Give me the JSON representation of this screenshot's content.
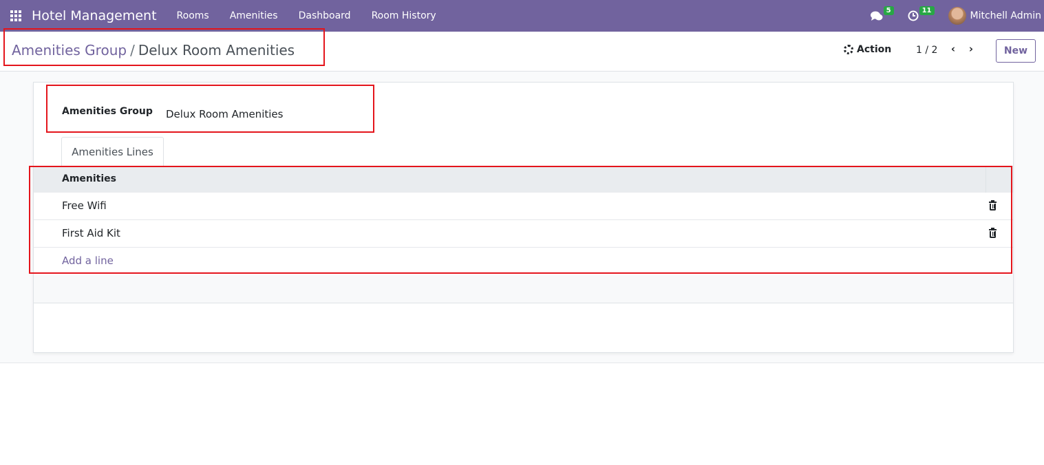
{
  "navbar": {
    "app_name": "Hotel Management",
    "menu": [
      "Rooms",
      "Amenities",
      "Dashboard",
      "Room History"
    ],
    "messages_count": "5",
    "activities_count": "11",
    "user_name": "Mitchell Admin",
    "bg_color": "#71639e"
  },
  "control_panel": {
    "breadcrumb_parent": "Amenities Group",
    "breadcrumb_separator": "/",
    "breadcrumb_current": "Delux Room Amenities",
    "action_label": "Action",
    "pager": "1 / 2",
    "new_label": "New"
  },
  "form": {
    "group_label": "Amenities Group",
    "group_value": "Delux Room Amenities",
    "tab_label": "Amenities Lines",
    "table": {
      "column_header": "Amenities",
      "rows": [
        "Free Wifi",
        "First Aid Kit"
      ],
      "add_line_label": "Add a line"
    }
  },
  "colors": {
    "accent": "#71639e",
    "annotation": "#e4141b",
    "badge": "#28a745"
  }
}
